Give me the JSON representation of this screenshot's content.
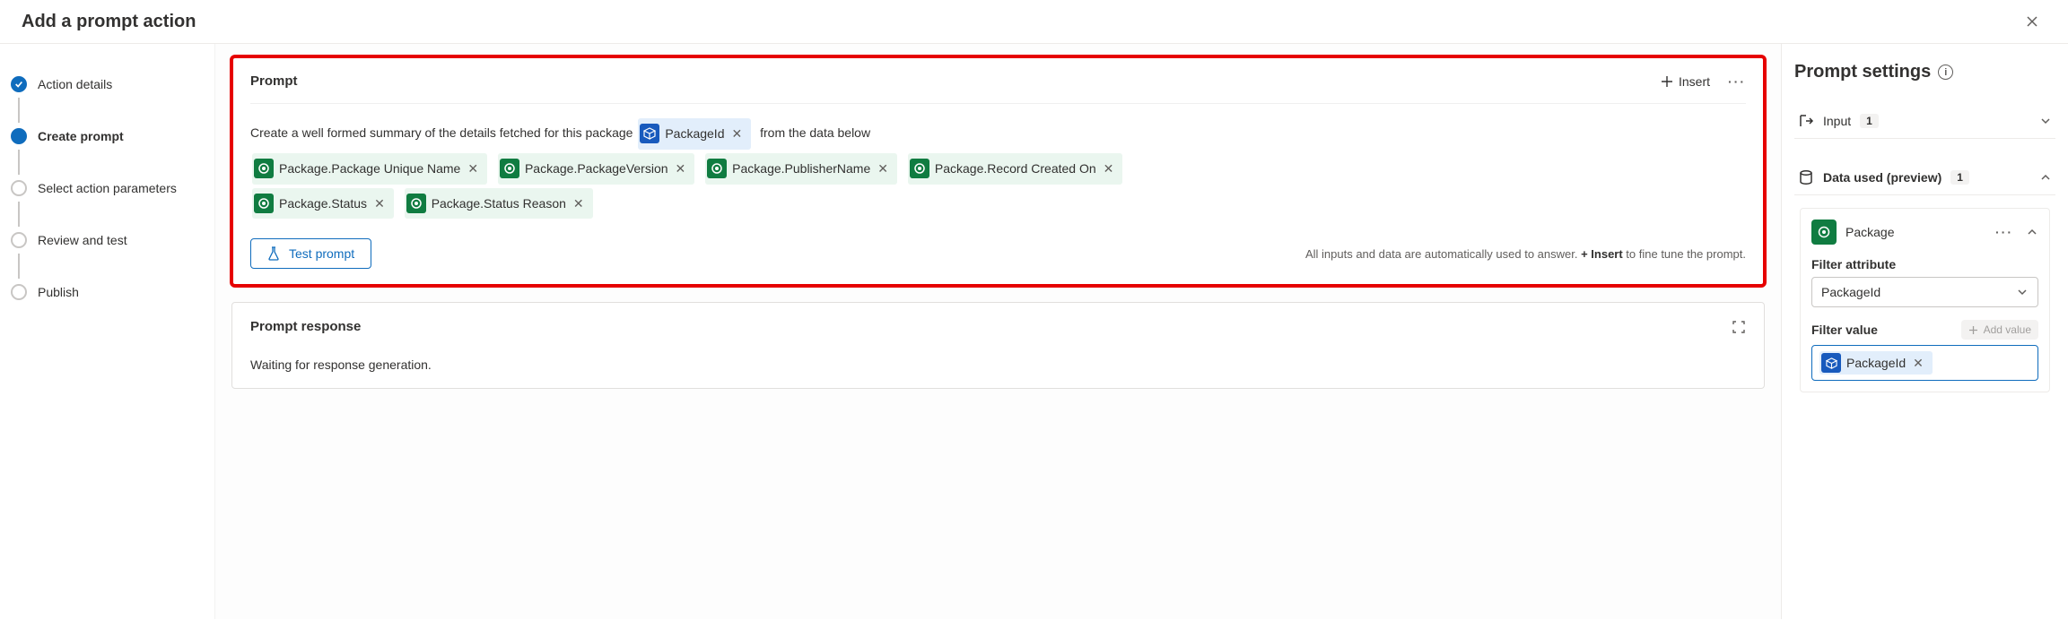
{
  "header": {
    "title": "Add a prompt action"
  },
  "steps": [
    {
      "label": "Action details",
      "state": "done"
    },
    {
      "label": "Create prompt",
      "state": "active"
    },
    {
      "label": "Select action parameters",
      "state": "pending"
    },
    {
      "label": "Review and test",
      "state": "pending"
    },
    {
      "label": "Publish",
      "state": "pending"
    }
  ],
  "prompt": {
    "title": "Prompt",
    "insert_label": "Insert",
    "text_prefix": "Create a well formed summary of the details fetched for this package",
    "inline_token": {
      "label": "PackageId"
    },
    "text_suffix": "from the data below",
    "tokens": [
      "Package.Package Unique Name",
      "Package.PackageVersion",
      "Package.PublisherName",
      "Package.Record Created On",
      "Package.Status",
      "Package.Status Reason"
    ],
    "test_label": "Test prompt",
    "hint_prefix": "All inputs and data are automatically used to answer. ",
    "hint_bold": "+ Insert",
    "hint_suffix": " to fine tune the prompt."
  },
  "response": {
    "title": "Prompt response",
    "body": "Waiting for response generation."
  },
  "settings": {
    "title": "Prompt settings",
    "input_label": "Input",
    "input_count": "1",
    "data_label": "Data used (preview)",
    "data_count": "1",
    "data_item_name": "Package",
    "filter_attr_label": "Filter attribute",
    "filter_attr_value": "PackageId",
    "filter_value_label": "Filter value",
    "add_value_label": "Add value",
    "filter_value_token": "PackageId"
  }
}
